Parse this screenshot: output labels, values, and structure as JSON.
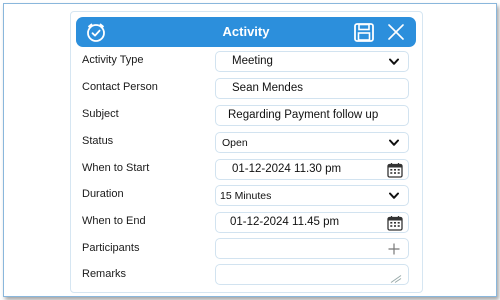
{
  "header": {
    "title": "Activity"
  },
  "form": {
    "activity_type": {
      "label": "Activity Type",
      "value": "Meeting"
    },
    "contact_person": {
      "label": "Contact Person",
      "value": "Sean Mendes"
    },
    "subject": {
      "label": "Subject",
      "value": "Regarding Payment follow up"
    },
    "status": {
      "label": "Status",
      "value": "Open"
    },
    "when_to_start": {
      "label": "When to Start",
      "value": "01-12-2024 11.30 pm"
    },
    "duration": {
      "label": "Duration",
      "value": "15 Minutes"
    },
    "when_to_end": {
      "label": "When to End",
      "value": "01-12-2024 11.45 pm"
    },
    "participants": {
      "label": "Participants",
      "value": ""
    },
    "remarks": {
      "label": "Remarks",
      "value": ""
    }
  },
  "colors": {
    "header_bg": "#2c8fdc",
    "field_border": "#d2e3f0",
    "card_border": "#d6e6f2"
  },
  "icons": {
    "header_left": "clock-check-icon",
    "save": "save-icon",
    "close": "close-icon",
    "dropdown": "chevron-down-icon",
    "date": "calendar-icon",
    "add": "plus-icon",
    "resize": "resize-grip-icon"
  }
}
